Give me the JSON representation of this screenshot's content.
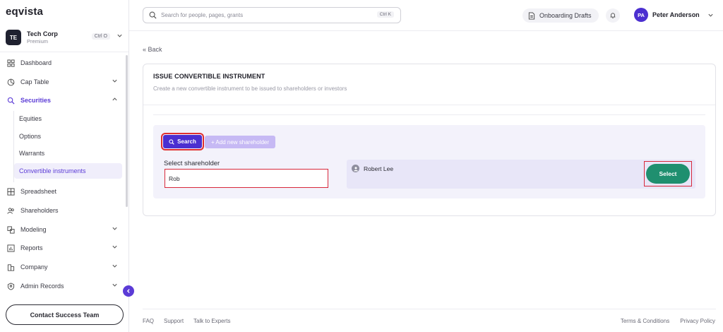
{
  "brand": {
    "logo": "eqvista"
  },
  "company": {
    "initials": "TE",
    "name": "Tech Corp",
    "plan": "Premium",
    "shortcut": "Ctrl O"
  },
  "sidebar": {
    "items": [
      {
        "label": "Dashboard",
        "icon": "dashboard-icon"
      },
      {
        "label": "Cap Table",
        "icon": "pie-chart-icon"
      },
      {
        "label": "Securities",
        "icon": "securities-icon"
      },
      {
        "label": "Spreadsheet",
        "icon": "spreadsheet-icon"
      },
      {
        "label": "Shareholders",
        "icon": "users-icon"
      },
      {
        "label": "Modeling",
        "icon": "modeling-icon"
      },
      {
        "label": "Reports",
        "icon": "reports-icon"
      },
      {
        "label": "Company",
        "icon": "company-icon"
      },
      {
        "label": "Admin Records",
        "icon": "admin-records-icon"
      }
    ],
    "securities_sub": [
      "Equities",
      "Options",
      "Warrants",
      "Convertible instruments"
    ],
    "contact_button": "Contact Success Team"
  },
  "topbar": {
    "search_placeholder": "Search for people, pages, grants",
    "search_shortcut": "Ctrl K",
    "drafts_label": "Onboarding Drafts",
    "user_initials": "PA",
    "user_name": "Peter Anderson"
  },
  "main": {
    "back_label": "« Back",
    "title": "ISSUE CONVERTIBLE INSTRUMENT",
    "subtitle": "Create a new convertible instrument to be issued to shareholders or investors",
    "search_button": "Search",
    "add_shareholder_button": "+ Add new shareholder",
    "select_label": "Select shareholder",
    "shareholder_input_value": "Rob",
    "result_name": "Robert Lee",
    "select_button": "Select"
  },
  "footer": {
    "left": [
      "FAQ",
      "Support",
      "Talk to Experts"
    ],
    "right": [
      "Terms & Conditions",
      "Privacy Policy"
    ]
  },
  "colors": {
    "accent": "#4b2fd0",
    "select_green": "#1f8f6f",
    "highlight_red": "#d8283b"
  }
}
